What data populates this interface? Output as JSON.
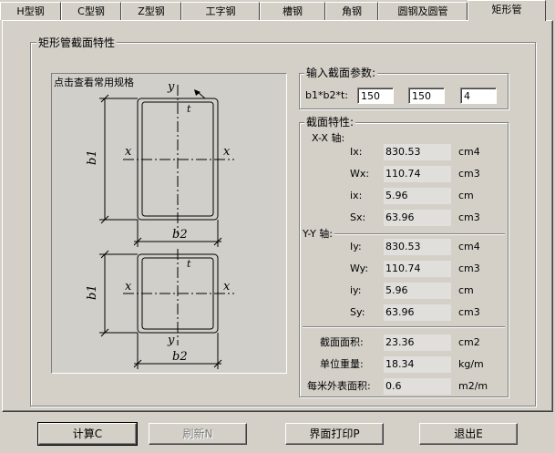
{
  "tabs": [
    {
      "label": "H型钢"
    },
    {
      "label": "C型钢"
    },
    {
      "label": "Z型钢"
    },
    {
      "label": "工字钢"
    },
    {
      "label": "槽钢"
    },
    {
      "label": "角钢"
    },
    {
      "label": "圆钢及圆管"
    },
    {
      "label": "矩形管"
    }
  ],
  "main_group": {
    "title": "矩形管截面特性"
  },
  "figure": {
    "link": "点击查看常用规格",
    "labels": {
      "x": "x",
      "y": "y",
      "t": "t",
      "b1": "b1",
      "b2": "b2"
    }
  },
  "input_group": {
    "title": "输入截面参数:",
    "param_label": "b1*b2*t:",
    "b1": "150",
    "b2": "150",
    "t": "4"
  },
  "props_group": {
    "title": "截面特性:",
    "xx_title": "X-X 轴:",
    "yy_title": "Y-Y 轴:",
    "xx": [
      {
        "name": "Ix:",
        "value": "830.53",
        "unit": "cm4"
      },
      {
        "name": "Wx:",
        "value": "110.74",
        "unit": "cm3"
      },
      {
        "name": "ix:",
        "value": "5.96",
        "unit": "cm"
      },
      {
        "name": "Sx:",
        "value": "63.96",
        "unit": "cm3"
      }
    ],
    "yy": [
      {
        "name": "Iy:",
        "value": "830.53",
        "unit": "cm4"
      },
      {
        "name": "Wy:",
        "value": "110.74",
        "unit": "cm3"
      },
      {
        "name": "iy:",
        "value": "5.96",
        "unit": "cm"
      },
      {
        "name": "Sy:",
        "value": "63.96",
        "unit": "cm3"
      }
    ],
    "extra": [
      {
        "name": "截面面积:",
        "value": "23.36",
        "unit": "cm2"
      },
      {
        "name": "单位重量:",
        "value": "18.34",
        "unit": "kg/m"
      },
      {
        "name": "每米外表面积:",
        "value": "0.6",
        "unit": "m2/m"
      }
    ]
  },
  "buttons": {
    "calc": "计算C",
    "refresh": "刷新N",
    "print": "界面打印P",
    "exit": "退出E"
  }
}
